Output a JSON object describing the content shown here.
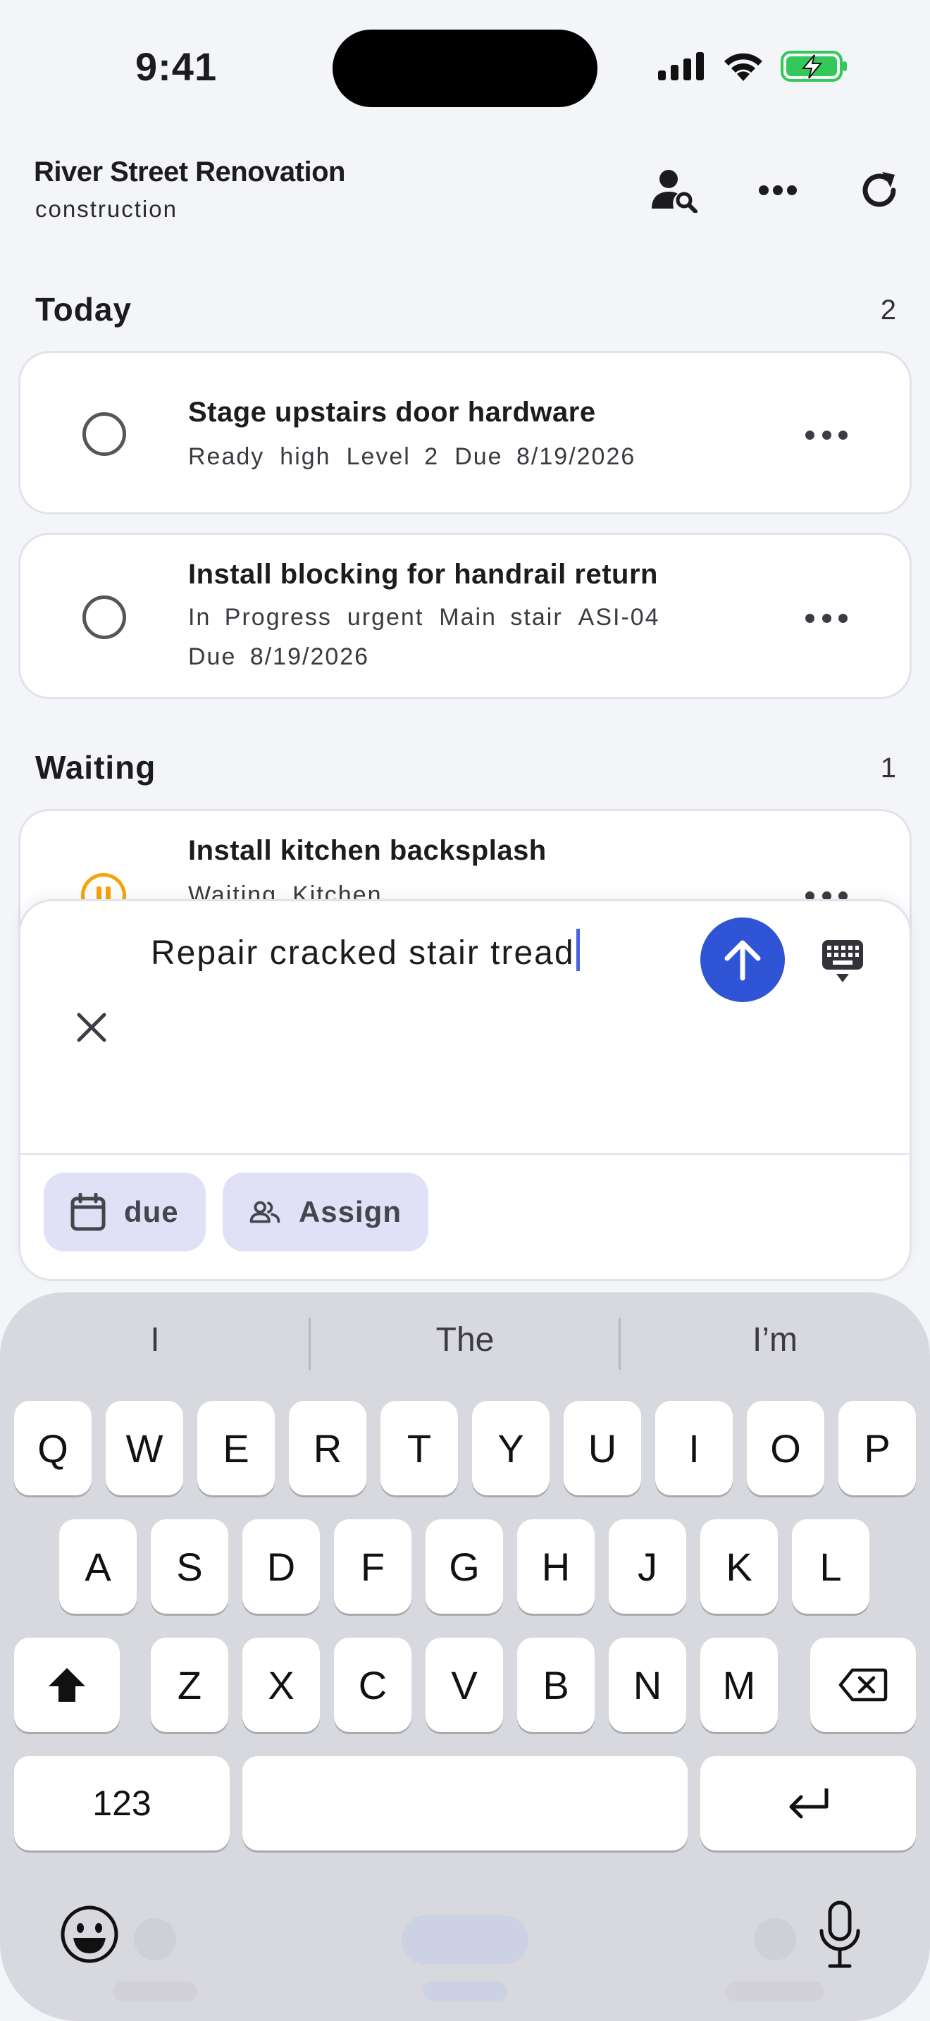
{
  "status_bar": {
    "time": "9:41"
  },
  "header": {
    "title": "River Street Renovation",
    "subtitle": "construction"
  },
  "sections": [
    {
      "title": "Today",
      "count": "2",
      "tasks": [
        {
          "title": "Stage upstairs door hardware",
          "meta": [
            "Ready",
            "high",
            "Level 2",
            "Due 8/19/2026"
          ]
        },
        {
          "title": "Install blocking for handrail return",
          "meta": [
            "In Progress",
            "urgent",
            "Main stair",
            "ASI-04"
          ],
          "meta2": "Due 8/19/2026"
        }
      ]
    },
    {
      "title": "Waiting",
      "count": "1",
      "tasks": [
        {
          "title": "Install kitchen backsplash",
          "meta": [
            "Waiting",
            "Kitchen"
          ]
        }
      ]
    }
  ],
  "composer": {
    "input_value": "Repair cracked stair tread",
    "chips": {
      "due_label": "due",
      "assign_label": "Assign"
    }
  },
  "keyboard": {
    "suggestions": [
      "I",
      "The",
      "I’m"
    ],
    "row1": [
      "Q",
      "W",
      "E",
      "R",
      "T",
      "Y",
      "U",
      "I",
      "O",
      "P"
    ],
    "row2": [
      "A",
      "S",
      "D",
      "F",
      "G",
      "H",
      "J",
      "K",
      "L"
    ],
    "row3": [
      "Z",
      "X",
      "C",
      "V",
      "B",
      "N",
      "M"
    ],
    "numbers_label": "123"
  },
  "colors": {
    "accent": "#2f54d6",
    "chip_bg": "#e0e1f6",
    "waiting": "#f5a30a",
    "battery": "#34c759"
  }
}
